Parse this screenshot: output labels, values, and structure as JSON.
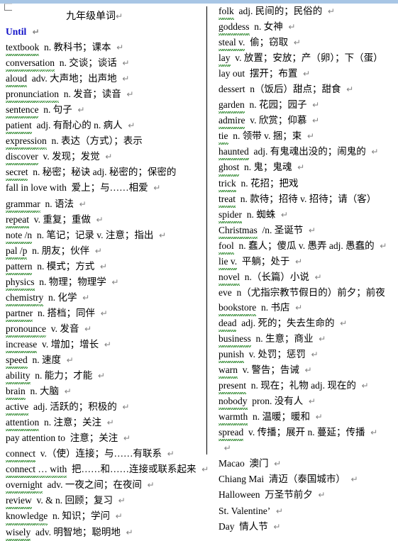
{
  "document": {
    "title": "九年级单词",
    "pilcrow": "↵",
    "colors": {
      "heading": "#1010c8",
      "spellcheck_squiggle": "#1e7d1e",
      "ruler_bar": "#a8c6e5",
      "column_divider": "#000000"
    }
  },
  "left_column": {
    "title": "九年级单词",
    "entries": [
      {
        "word": "Until",
        "body": "",
        "heading": true,
        "spell": false,
        "eol": true,
        "gap": ""
      },
      {
        "word": "textbook",
        "body": "n. 教科书；课本",
        "spell": true,
        "eol": true
      },
      {
        "word": "conversation",
        "body": "n. 交谈；谈话",
        "spell": true,
        "eol": true
      },
      {
        "word": "aloud",
        "body": "adv. 大声地；出声地",
        "spell": true,
        "eol": true
      },
      {
        "word": "pronunciation",
        "body": "n. 发音；读音",
        "spell": true,
        "eol": true
      },
      {
        "word": "sentence",
        "body": "n. 句子",
        "spell": true,
        "eol": true
      },
      {
        "word": "patient",
        "body": "adj. 有耐心的  n. 病人",
        "spell": true,
        "eol": true
      },
      {
        "word": "expression",
        "body": "n. 表达（方式）；表示",
        "spell": true,
        "eol": false
      },
      {
        "word": "discover",
        "body": "v. 发现；发觉",
        "spell": true,
        "eol": true
      },
      {
        "word": "secret",
        "body": "n. 秘密；秘诀  adj. 秘密的；保密的",
        "spell": true,
        "eol": false
      },
      {
        "word": "fall in love with",
        "body": "爱上；与……相爱",
        "spell": false,
        "eol": true
      },
      {
        "word": "grammar",
        "body": "n. 语法",
        "spell": true,
        "eol": true
      },
      {
        "word": "repeat",
        "body": "v. 重复；重做",
        "spell": true,
        "eol": true
      },
      {
        "word": "note /n",
        "body": "n. 笔记；记录 v. 注意；指出",
        "spell": true,
        "eol": true
      },
      {
        "word": "pal /p",
        "body": "n. 朋友；伙伴",
        "spell": true,
        "eol": true
      },
      {
        "word": "pattern",
        "body": "n. 模式；方式",
        "spell": true,
        "eol": true
      },
      {
        "word": "physics",
        "body": "n. 物理；物理学",
        "spell": true,
        "eol": true
      },
      {
        "word": "chemistry",
        "body": "n. 化学",
        "spell": true,
        "eol": true
      },
      {
        "word": "partner",
        "body": "n. 搭档；同伴",
        "spell": true,
        "eol": true
      },
      {
        "word": "pronounce",
        "body": "v. 发音",
        "spell": true,
        "eol": true
      },
      {
        "word": "increase",
        "body": "v. 增加；增长",
        "spell": true,
        "eol": true
      },
      {
        "word": "speed",
        "body": "n. 速度",
        "spell": true,
        "eol": true
      },
      {
        "word": "ability",
        "body": "n. 能力；才能",
        "spell": true,
        "eol": true
      },
      {
        "word": "brain",
        "body": "n. 大脑",
        "spell": true,
        "eol": true
      },
      {
        "word": "active",
        "body": "adj. 活跃的；积极的",
        "spell": true,
        "eol": true
      },
      {
        "word": "attention",
        "body": "n. 注意；关注",
        "spell": true,
        "eol": true
      },
      {
        "word": "pay attention to",
        "body": "注意；关注",
        "spell": false,
        "eol": true
      },
      {
        "word": "connect",
        "body": "v.（使）连接；与……有联系",
        "spell": true,
        "eol": true
      },
      {
        "word": "connect … with",
        "body": "把……和……连接或联系起来",
        "spell": true,
        "eol": true
      },
      {
        "word": "overnight",
        "body": "adv. 一夜之间；在夜间",
        "spell": true,
        "eol": true
      },
      {
        "word": "review",
        "body": "v. & n. 回顾；复习",
        "spell": true,
        "eol": true
      },
      {
        "word": "knowledge",
        "body": "n.  知识；学问",
        "spell": true,
        "eol": true
      },
      {
        "word": "wisely",
        "body": "adv. 明智地；聪明地",
        "spell": true,
        "eol": true
      }
    ]
  },
  "right_column": {
    "entries": [
      {
        "word": "folk",
        "body": "adj. 民间的；民俗的",
        "spell": true,
        "eol": true
      },
      {
        "word": "goddess",
        "body": "n. 女神",
        "spell": true,
        "eol": true
      },
      {
        "word": "steal v.",
        "body": "偷；窃取",
        "spell": true,
        "eol": true
      },
      {
        "word": "lay",
        "body": "v.  放置；安放；产（卵）；下（蛋）",
        "spell": true,
        "eol": false
      },
      {
        "word": "lay out",
        "body": "摆开；布置",
        "spell": false,
        "eol": true
      },
      {
        "word": "dessert",
        "body": "n（饭后）甜点；甜食",
        "spell": false,
        "eol": true
      },
      {
        "word": "garden",
        "body": "n. 花园；园子",
        "spell": true,
        "eol": true
      },
      {
        "word": "admire",
        "body": "v. 欣赏；仰慕",
        "spell": true,
        "eol": true
      },
      {
        "word": "tie",
        "body": "n.  领带 v. 捆；束",
        "spell": true,
        "eol": true
      },
      {
        "word": "haunted",
        "body": "adj. 有鬼魂出没的；闹鬼的",
        "spell": true,
        "eol": true
      },
      {
        "word": "ghost",
        "body": "n. 鬼；鬼魂",
        "spell": true,
        "eol": true
      },
      {
        "word": "trick",
        "body": "n. 花招；把戏",
        "spell": true,
        "eol": false
      },
      {
        "word": "treat",
        "body": "n. 款待；招待 v. 招待；请（客）",
        "spell": true,
        "eol": false
      },
      {
        "word": "spider",
        "body": "n. 蜘蛛",
        "spell": true,
        "eol": true
      },
      {
        "word": "Christmas",
        "body": "/n. 圣诞节",
        "spell": true,
        "eol": true
      },
      {
        "word": "fool",
        "body": "n. 蠢人；傻瓜   v. 愚弄 adj.  愚蠢的",
        "spell": true,
        "eol": true
      },
      {
        "word": "lie v.",
        "body": "平躺；处于",
        "spell": true,
        "eol": true
      },
      {
        "word": "novel",
        "body": "n.（长篇）小说",
        "spell": true,
        "eol": true
      },
      {
        "word": "eve",
        "body": "n（尤指宗教节假日的）前夕；前夜",
        "spell": false,
        "eol": false
      },
      {
        "word": "bookstore",
        "body": "n. 书店",
        "spell": true,
        "eol": true
      },
      {
        "word": "dead",
        "body": "adj. 死的；失去生命的",
        "spell": true,
        "eol": true
      },
      {
        "word": "business",
        "body": "n. 生意；商业",
        "spell": true,
        "eol": true
      },
      {
        "word": "punish",
        "body": "v.  处罚；惩罚",
        "spell": true,
        "eol": true
      },
      {
        "word": "warn",
        "body": "v. 警告；告诫",
        "spell": true,
        "eol": true
      },
      {
        "word": "present",
        "body": "n. 现在；礼物 adj. 现在的",
        "spell": true,
        "eol": true
      },
      {
        "word": "nobody",
        "body": "pron. 没有人",
        "spell": true,
        "eol": true
      },
      {
        "word": "warmth",
        "body": "n. 温暖；暖和",
        "spell": true,
        "eol": true
      },
      {
        "word": "spread",
        "body": "v.  传播；展开 n. 蔓延；传播",
        "spell": true,
        "eol": true
      },
      {
        "word": "",
        "body": "",
        "spell": false,
        "eol": true
      },
      {
        "word": "Macao",
        "body": "澳门",
        "spell": false,
        "eol": true
      },
      {
        "word": "Chiang Mai",
        "body": "清迈（泰国城市）",
        "spell": false,
        "eol": true
      },
      {
        "word": "Halloween",
        "body": "万圣节前夕",
        "spell": false,
        "eol": true
      },
      {
        "word": "St.    Valentine’",
        "body": "",
        "spell": false,
        "eol": true
      },
      {
        "word": "Day",
        "body": "情人节",
        "spell": false,
        "eol": true
      }
    ]
  }
}
